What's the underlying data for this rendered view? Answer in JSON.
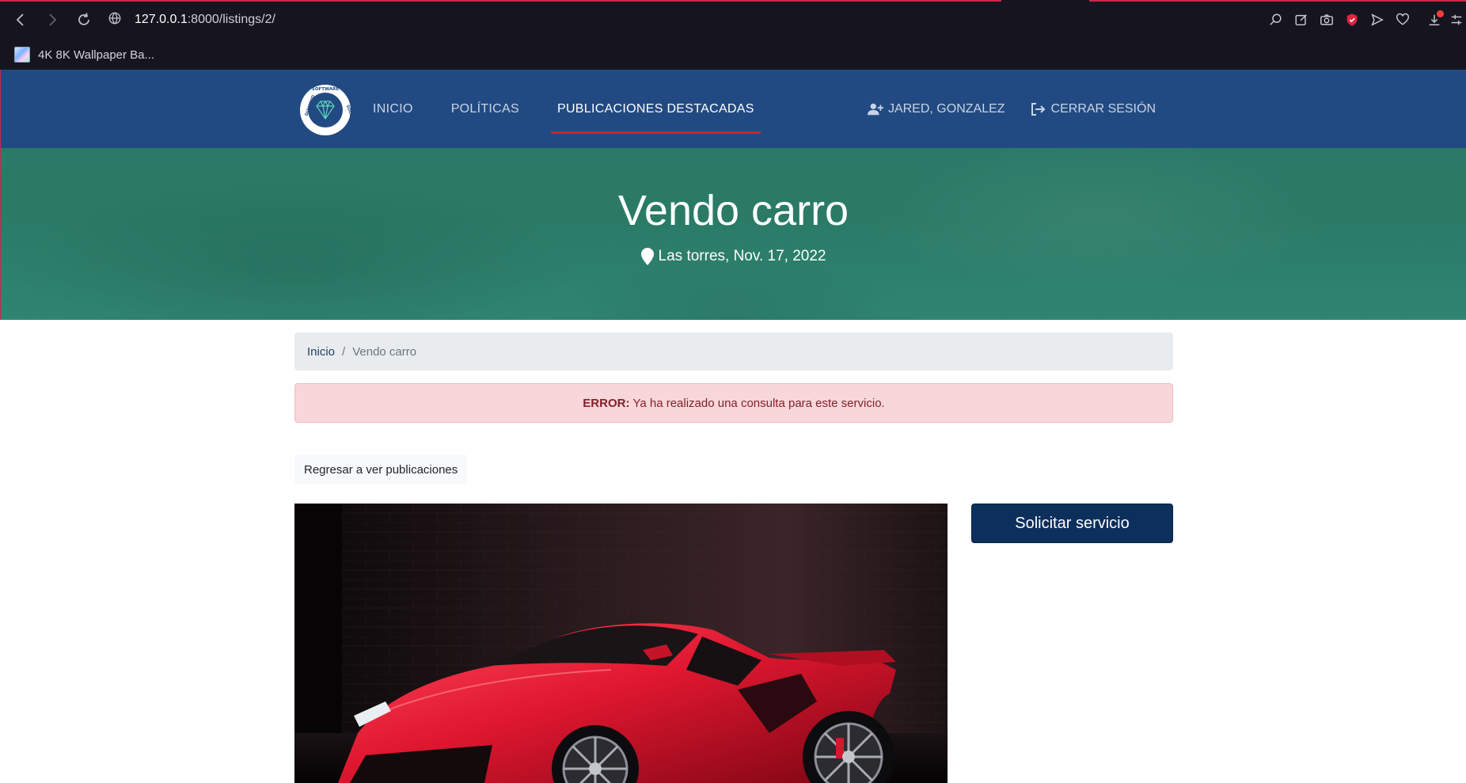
{
  "browser": {
    "url_host": "127.0.0.1",
    "url_path": ":8000/listings/2/",
    "bookmark_label": "4K 8K Wallpaper Ba..."
  },
  "nav": {
    "links": [
      "INICIO",
      "POLÍTICAS",
      "PUBLICACIONES DESTACADAS"
    ],
    "active_index": 2,
    "user_label": "JARED, GONZALEZ",
    "logout_label": "CERRAR SESIÓN",
    "logo_text": "DIAMOND SOFTWARE SOLUTIONS"
  },
  "hero": {
    "title": "Vendo carro",
    "location_date": "Las torres, Nov. 17, 2022"
  },
  "breadcrumb": {
    "home": "Inicio",
    "separator": "/",
    "current": "Vendo carro"
  },
  "alert": {
    "label": "ERROR:",
    "message": "Ya ha realizado una consulta para este servicio."
  },
  "actions": {
    "back_label": "Regresar a ver publicaciones",
    "request_label": "Solicitar servicio"
  },
  "colors": {
    "nav_bg": "#224a82",
    "hero_bg": "#2b7a67",
    "active_underline": "#d21e36",
    "alert_bg": "#f7d7da",
    "request_button": "#0d2f5c"
  }
}
